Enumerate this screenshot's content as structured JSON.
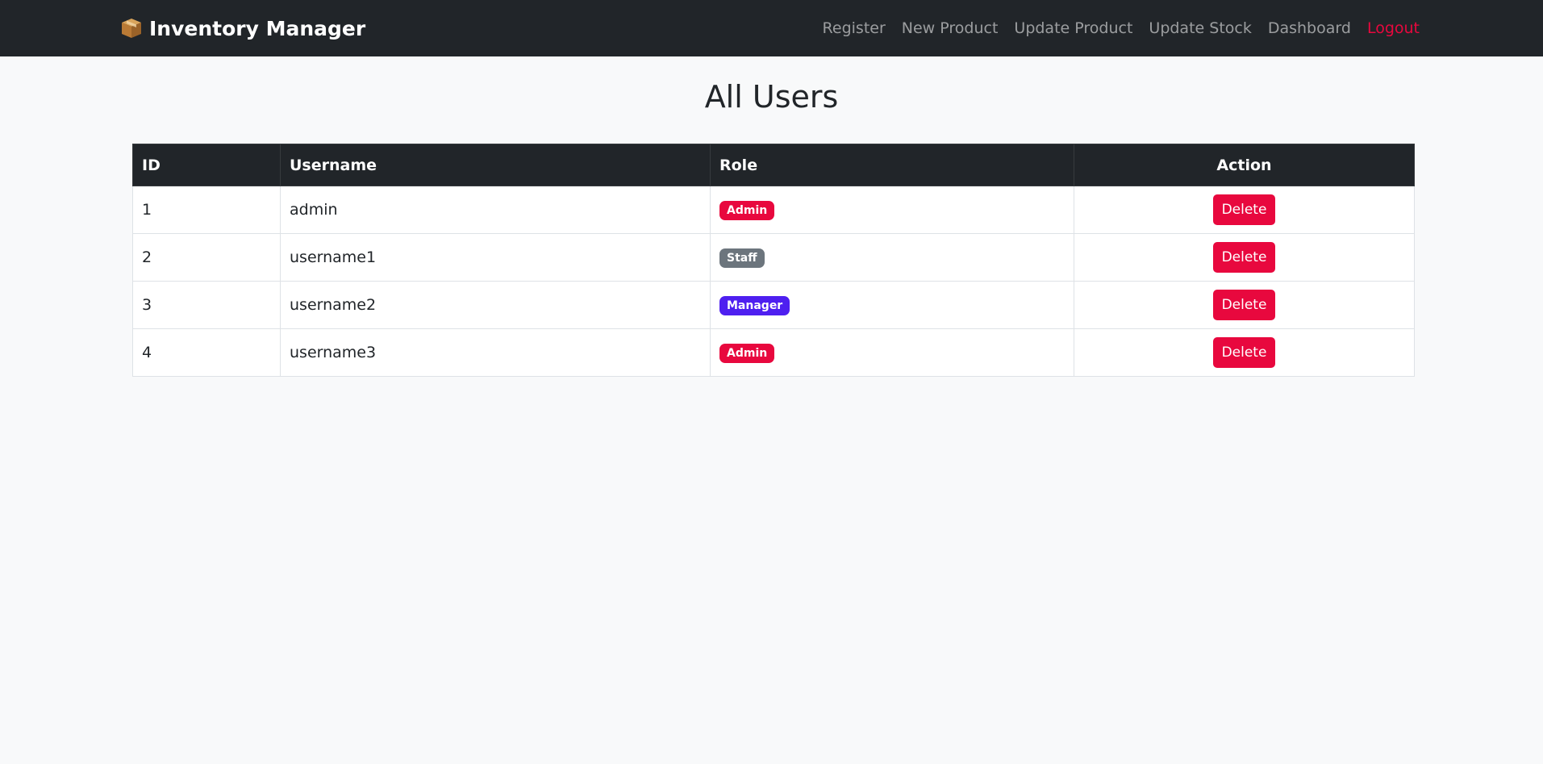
{
  "navbar": {
    "brand": "Inventory Manager",
    "brand_icon": "package-icon",
    "links": [
      {
        "label": "Register"
      },
      {
        "label": "New Product"
      },
      {
        "label": "Update Product"
      },
      {
        "label": "Update Stock"
      },
      {
        "label": "Dashboard"
      },
      {
        "label": "Logout"
      }
    ]
  },
  "page": {
    "title": "All Users"
  },
  "table": {
    "headers": {
      "id": "ID",
      "username": "Username",
      "role": "Role",
      "action": "Action"
    },
    "rows": [
      {
        "id": "1",
        "username": "admin",
        "role": "Admin",
        "action": "Delete"
      },
      {
        "id": "2",
        "username": "username1",
        "role": "Staff",
        "action": "Delete"
      },
      {
        "id": "3",
        "username": "username2",
        "role": "Manager",
        "action": "Delete"
      },
      {
        "id": "4",
        "username": "username3",
        "role": "Admin",
        "action": "Delete"
      }
    ]
  },
  "colors": {
    "navbar_bg": "#212529",
    "danger": "#e8083e",
    "badge_staff": "#6c757d",
    "badge_manager": "#4e1ff0",
    "page_bg": "#f8f9fa"
  }
}
